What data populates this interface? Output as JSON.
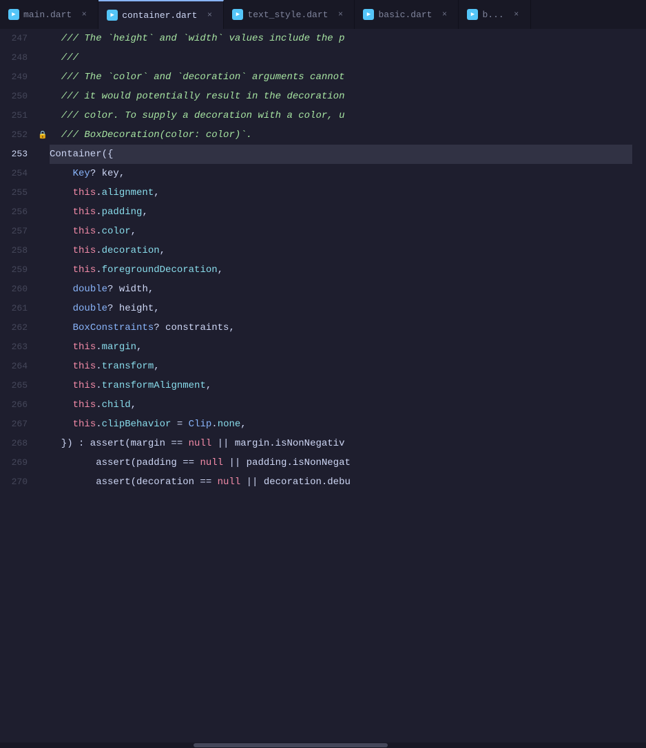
{
  "tabs": [
    {
      "label": "main.dart",
      "active": false,
      "color": "#54c5f8"
    },
    {
      "label": "container.dart",
      "active": true,
      "color": "#54c5f8"
    },
    {
      "label": "text_style.dart",
      "active": false,
      "color": "#54c5f8"
    },
    {
      "label": "basic.dart",
      "active": false,
      "color": "#54c5f8"
    },
    {
      "label": "b...",
      "active": false,
      "color": "#54c5f8"
    }
  ],
  "lines": [
    {
      "num": "247",
      "active": false,
      "gutter": "",
      "tokens": [
        {
          "text": "  /// The `height` and `width` values include the p",
          "class": "c-comment-green"
        }
      ]
    },
    {
      "num": "248",
      "active": false,
      "gutter": "",
      "tokens": [
        {
          "text": "  ///",
          "class": "c-comment-green"
        }
      ]
    },
    {
      "num": "249",
      "active": false,
      "gutter": "",
      "tokens": [
        {
          "text": "  /// The `color` and `decoration` arguments cannot",
          "class": "c-comment-green"
        }
      ]
    },
    {
      "num": "250",
      "active": false,
      "gutter": "",
      "tokens": [
        {
          "text": "  /// it would potentially result in the decoration",
          "class": "c-comment-green"
        }
      ]
    },
    {
      "num": "251",
      "active": false,
      "gutter": "",
      "tokens": [
        {
          "text": "  /// color. To supply a decoration with a color, u",
          "class": "c-comment-green"
        }
      ]
    },
    {
      "num": "252",
      "active": false,
      "gutter": "lock",
      "tokens": [
        {
          "text": "  /// BoxDecoration(color: color)`.",
          "class": "c-comment-green"
        }
      ]
    },
    {
      "num": "253",
      "active": true,
      "gutter": "",
      "tokens": [
        {
          "text": "Container({",
          "class": "c-plain"
        }
      ]
    },
    {
      "num": "254",
      "active": false,
      "gutter": "",
      "tokens": [
        {
          "text": "    ",
          "class": "c-plain"
        },
        {
          "text": "Key",
          "class": "c-type"
        },
        {
          "text": "? key,",
          "class": "c-plain"
        }
      ]
    },
    {
      "num": "255",
      "active": false,
      "gutter": "",
      "tokens": [
        {
          "text": "    ",
          "class": "c-plain"
        },
        {
          "text": "this",
          "class": "c-this"
        },
        {
          "text": ".",
          "class": "c-plain"
        },
        {
          "text": "alignment",
          "class": "c-property"
        },
        {
          "text": ",",
          "class": "c-plain"
        }
      ]
    },
    {
      "num": "256",
      "active": false,
      "gutter": "",
      "tokens": [
        {
          "text": "    ",
          "class": "c-plain"
        },
        {
          "text": "this",
          "class": "c-this"
        },
        {
          "text": ".",
          "class": "c-plain"
        },
        {
          "text": "padding",
          "class": "c-property"
        },
        {
          "text": ",",
          "class": "c-plain"
        }
      ]
    },
    {
      "num": "257",
      "active": false,
      "gutter": "",
      "tokens": [
        {
          "text": "    ",
          "class": "c-plain"
        },
        {
          "text": "this",
          "class": "c-this"
        },
        {
          "text": ".",
          "class": "c-plain"
        },
        {
          "text": "color",
          "class": "c-property"
        },
        {
          "text": ",",
          "class": "c-plain"
        }
      ]
    },
    {
      "num": "258",
      "active": false,
      "gutter": "",
      "tokens": [
        {
          "text": "    ",
          "class": "c-plain"
        },
        {
          "text": "this",
          "class": "c-this"
        },
        {
          "text": ".",
          "class": "c-plain"
        },
        {
          "text": "decoration",
          "class": "c-property"
        },
        {
          "text": ",",
          "class": "c-plain"
        }
      ]
    },
    {
      "num": "259",
      "active": false,
      "gutter": "",
      "tokens": [
        {
          "text": "    ",
          "class": "c-plain"
        },
        {
          "text": "this",
          "class": "c-this"
        },
        {
          "text": ".",
          "class": "c-plain"
        },
        {
          "text": "foregroundDecoration",
          "class": "c-property"
        },
        {
          "text": ",",
          "class": "c-plain"
        }
      ]
    },
    {
      "num": "260",
      "active": false,
      "gutter": "",
      "tokens": [
        {
          "text": "    ",
          "class": "c-plain"
        },
        {
          "text": "double",
          "class": "c-type"
        },
        {
          "text": "? width,",
          "class": "c-plain"
        }
      ]
    },
    {
      "num": "261",
      "active": false,
      "gutter": "",
      "tokens": [
        {
          "text": "    ",
          "class": "c-plain"
        },
        {
          "text": "double",
          "class": "c-type"
        },
        {
          "text": "? height,",
          "class": "c-plain"
        }
      ]
    },
    {
      "num": "262",
      "active": false,
      "gutter": "",
      "tokens": [
        {
          "text": "    ",
          "class": "c-plain"
        },
        {
          "text": "BoxConstraints",
          "class": "c-type"
        },
        {
          "text": "? constraints,",
          "class": "c-plain"
        }
      ]
    },
    {
      "num": "263",
      "active": false,
      "gutter": "",
      "tokens": [
        {
          "text": "    ",
          "class": "c-plain"
        },
        {
          "text": "this",
          "class": "c-this"
        },
        {
          "text": ".",
          "class": "c-plain"
        },
        {
          "text": "margin",
          "class": "c-property"
        },
        {
          "text": ",",
          "class": "c-plain"
        }
      ]
    },
    {
      "num": "264",
      "active": false,
      "gutter": "",
      "tokens": [
        {
          "text": "    ",
          "class": "c-plain"
        },
        {
          "text": "this",
          "class": "c-this"
        },
        {
          "text": ".",
          "class": "c-plain"
        },
        {
          "text": "transform",
          "class": "c-property"
        },
        {
          "text": ",",
          "class": "c-plain"
        }
      ]
    },
    {
      "num": "265",
      "active": false,
      "gutter": "",
      "tokens": [
        {
          "text": "    ",
          "class": "c-plain"
        },
        {
          "text": "this",
          "class": "c-this"
        },
        {
          "text": ".",
          "class": "c-plain"
        },
        {
          "text": "transformAlignment",
          "class": "c-property"
        },
        {
          "text": ",",
          "class": "c-plain"
        }
      ]
    },
    {
      "num": "266",
      "active": false,
      "gutter": "",
      "tokens": [
        {
          "text": "    ",
          "class": "c-plain"
        },
        {
          "text": "this",
          "class": "c-this"
        },
        {
          "text": ".",
          "class": "c-plain"
        },
        {
          "text": "child",
          "class": "c-property"
        },
        {
          "text": ",",
          "class": "c-plain"
        }
      ]
    },
    {
      "num": "267",
      "active": false,
      "gutter": "",
      "tokens": [
        {
          "text": "    ",
          "class": "c-plain"
        },
        {
          "text": "this",
          "class": "c-this"
        },
        {
          "text": ".",
          "class": "c-plain"
        },
        {
          "text": "clipBehavior",
          "class": "c-property"
        },
        {
          "text": " = ",
          "class": "c-plain"
        },
        {
          "text": "Clip",
          "class": "c-type"
        },
        {
          "text": ".",
          "class": "c-plain"
        },
        {
          "text": "none",
          "class": "c-property"
        },
        {
          "text": ",",
          "class": "c-plain"
        }
      ]
    },
    {
      "num": "268",
      "active": false,
      "gutter": "",
      "tokens": [
        {
          "text": "  }) : assert(margin == ",
          "class": "c-plain"
        },
        {
          "text": "null",
          "class": "c-null"
        },
        {
          "text": " || margin.isNonNegativ",
          "class": "c-plain"
        }
      ]
    },
    {
      "num": "269",
      "active": false,
      "gutter": "",
      "tokens": [
        {
          "text": "        assert(padding == ",
          "class": "c-plain"
        },
        {
          "text": "null",
          "class": "c-null"
        },
        {
          "text": " || padding.isNonNegat",
          "class": "c-plain"
        }
      ]
    },
    {
      "num": "270",
      "active": false,
      "gutter": "",
      "tokens": [
        {
          "text": "        assert(decoration == ",
          "class": "c-plain"
        },
        {
          "text": "null",
          "class": "c-null"
        },
        {
          "text": " || decoration.debu",
          "class": "c-plain"
        }
      ]
    }
  ]
}
